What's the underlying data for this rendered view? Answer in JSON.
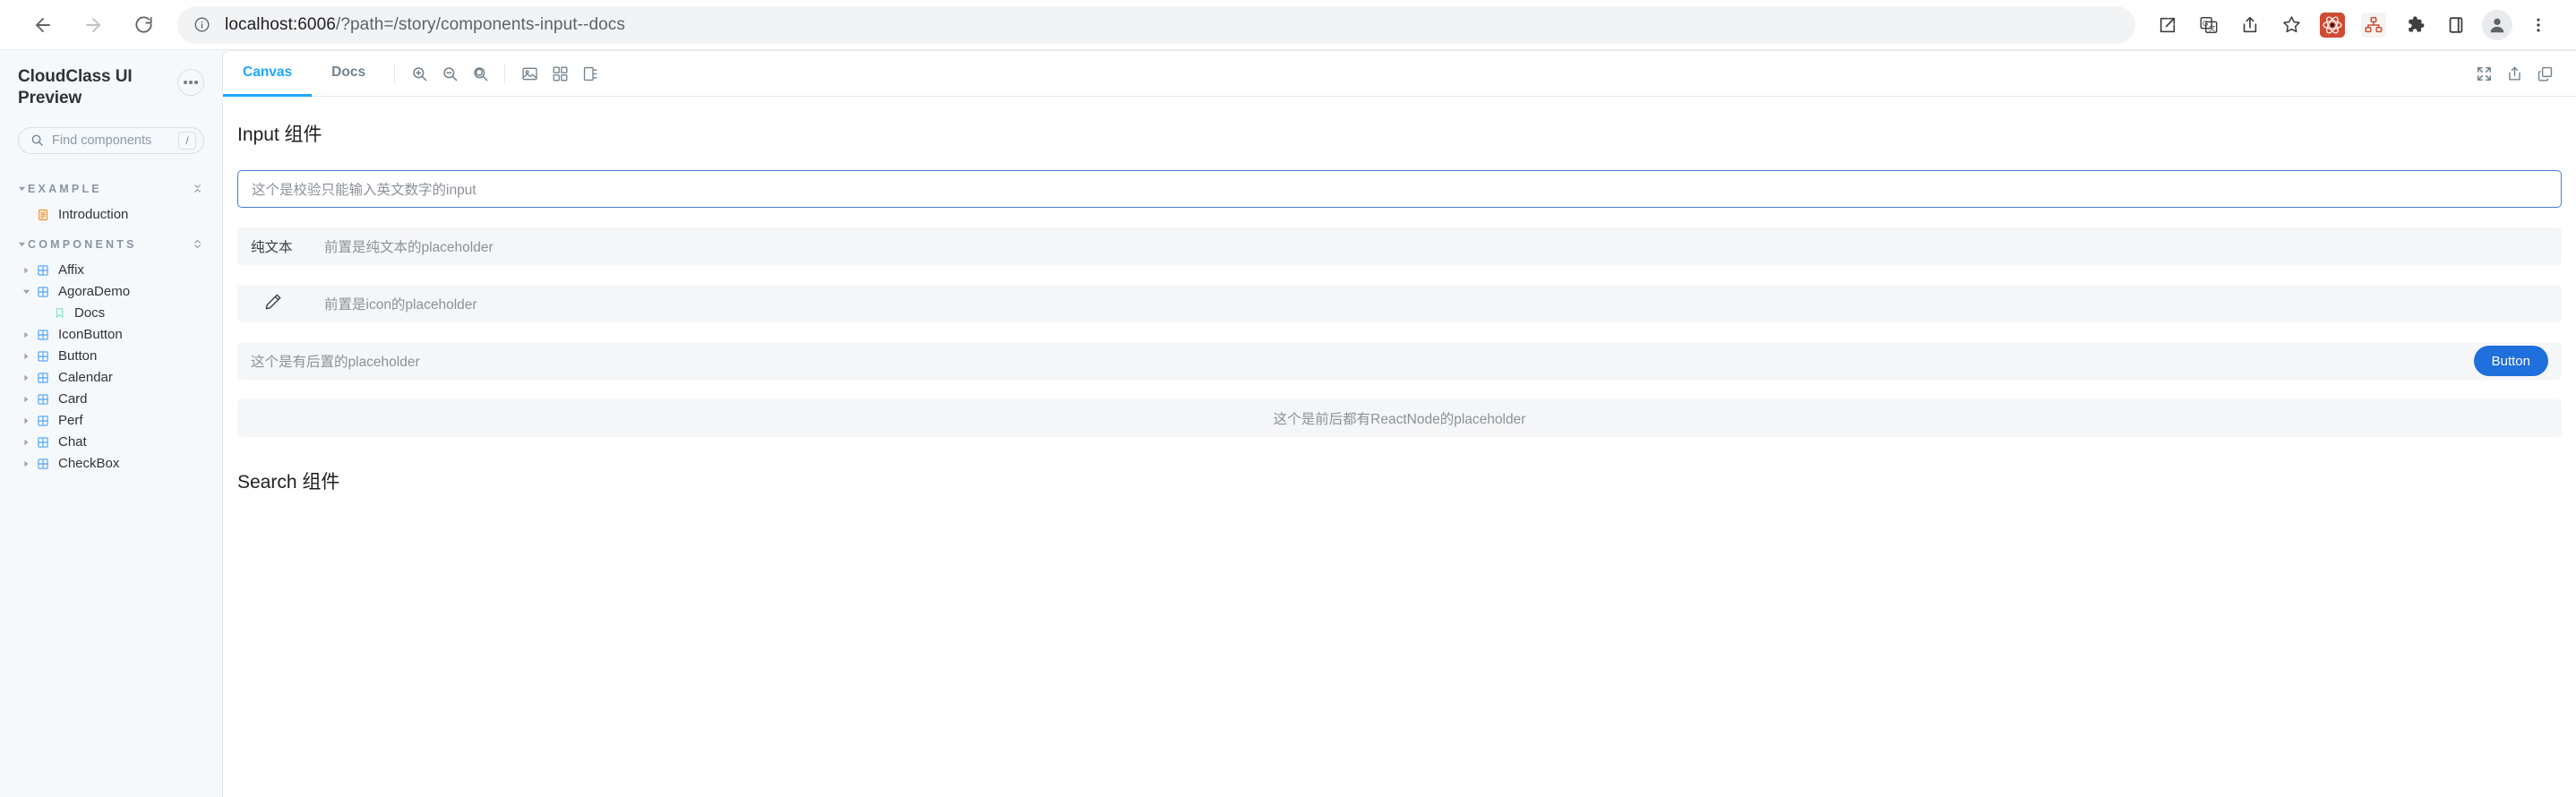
{
  "browser": {
    "back_label": "Back",
    "forward_label": "Forward",
    "reload_label": "Reload",
    "url_host": "localhost:6006",
    "url_path": "/?path=/story/components-input--docs",
    "toolbar_icons": [
      "external-link-icon",
      "translate-icon",
      "share-icon",
      "bookmark-star-icon",
      "react-devtools-extension-icon",
      "component-tree-extension-icon",
      "extensions-puzzle-icon",
      "side-panel-icon",
      "profile-avatar-icon",
      "chrome-menu-icon"
    ]
  },
  "sidebar": {
    "title": "CloudClass UI Preview",
    "menu_button_label": "•••",
    "search": {
      "placeholder": "Find components",
      "value": "",
      "shortcut": "/"
    },
    "sections": [
      {
        "label": "EXAMPLE",
        "expanded": true,
        "items": [
          {
            "label": "Introduction",
            "icon": "document-icon",
            "kind": "doc",
            "depth": 0,
            "expandable": false
          }
        ]
      },
      {
        "label": "COMPONENTS",
        "expanded": true,
        "items": [
          {
            "label": "Affix",
            "icon": "component-grid-icon",
            "kind": "component",
            "depth": 0,
            "expandable": true,
            "expanded": false
          },
          {
            "label": "AgoraDemo",
            "icon": "component-grid-icon",
            "kind": "component",
            "depth": 0,
            "expandable": true,
            "expanded": true
          },
          {
            "label": "Docs",
            "icon": "bookmark-icon",
            "kind": "docs",
            "depth": 1,
            "expandable": false
          },
          {
            "label": "IconButton",
            "icon": "component-grid-icon",
            "kind": "component",
            "depth": 0,
            "expandable": true,
            "expanded": false
          },
          {
            "label": "Button",
            "icon": "component-grid-icon",
            "kind": "component",
            "depth": 0,
            "expandable": true,
            "expanded": false
          },
          {
            "label": "Calendar",
            "icon": "component-grid-icon",
            "kind": "component",
            "depth": 0,
            "expandable": true,
            "expanded": false
          },
          {
            "label": "Card",
            "icon": "component-grid-icon",
            "kind": "component",
            "depth": 0,
            "expandable": true,
            "expanded": false
          },
          {
            "label": "Perf",
            "icon": "component-grid-icon",
            "kind": "component",
            "depth": 0,
            "expandable": true,
            "expanded": false
          },
          {
            "label": "Chat",
            "icon": "component-grid-icon",
            "kind": "component",
            "depth": 0,
            "expandable": true,
            "expanded": false
          },
          {
            "label": "CheckBox",
            "icon": "component-grid-icon",
            "kind": "component",
            "depth": 0,
            "expandable": true,
            "expanded": false
          }
        ]
      }
    ]
  },
  "main": {
    "tabs": [
      {
        "label": "Canvas",
        "active": true
      },
      {
        "label": "Docs",
        "active": false
      }
    ],
    "tools": [
      "zoom-in-icon",
      "zoom-out-icon",
      "zoom-reset-icon"
    ],
    "tools2": [
      "background-icon",
      "grid-icon",
      "measure-icon"
    ],
    "tools_right": [
      "fullscreen-icon",
      "open-in-new-tab-icon",
      "copy-link-icon"
    ]
  },
  "story": {
    "heading_input": "Input 组件",
    "heading_search": "Search 组件",
    "focused_input_placeholder": "这个是校验只能输入英文数字的input",
    "rows": [
      {
        "prefix_type": "text",
        "prefix_text": "纯文本",
        "placeholder": "前置是纯文本的placeholder",
        "suffix_type": "none"
      },
      {
        "prefix_type": "icon",
        "prefix_icon": "pencil-icon",
        "placeholder": "前置是icon的placeholder",
        "suffix_type": "none"
      },
      {
        "prefix_type": "none",
        "placeholder": "这个是有后置的placeholder",
        "suffix_type": "button",
        "suffix_button_label": "Button"
      },
      {
        "prefix_type": "none",
        "placeholder": "这个是前后都有ReactNode的placeholder",
        "suffix_type": "none",
        "centered": true
      }
    ]
  },
  "colors": {
    "accent": "#1ea7fd",
    "button_blue": "#1f6fdc",
    "focus_border": "#4a7bd4",
    "sidebar_bg": "#f6f9fc",
    "component_icon": "#4ba3f5",
    "doc_icon": "#f08c1a",
    "docs_icon": "#7ddfc3"
  }
}
